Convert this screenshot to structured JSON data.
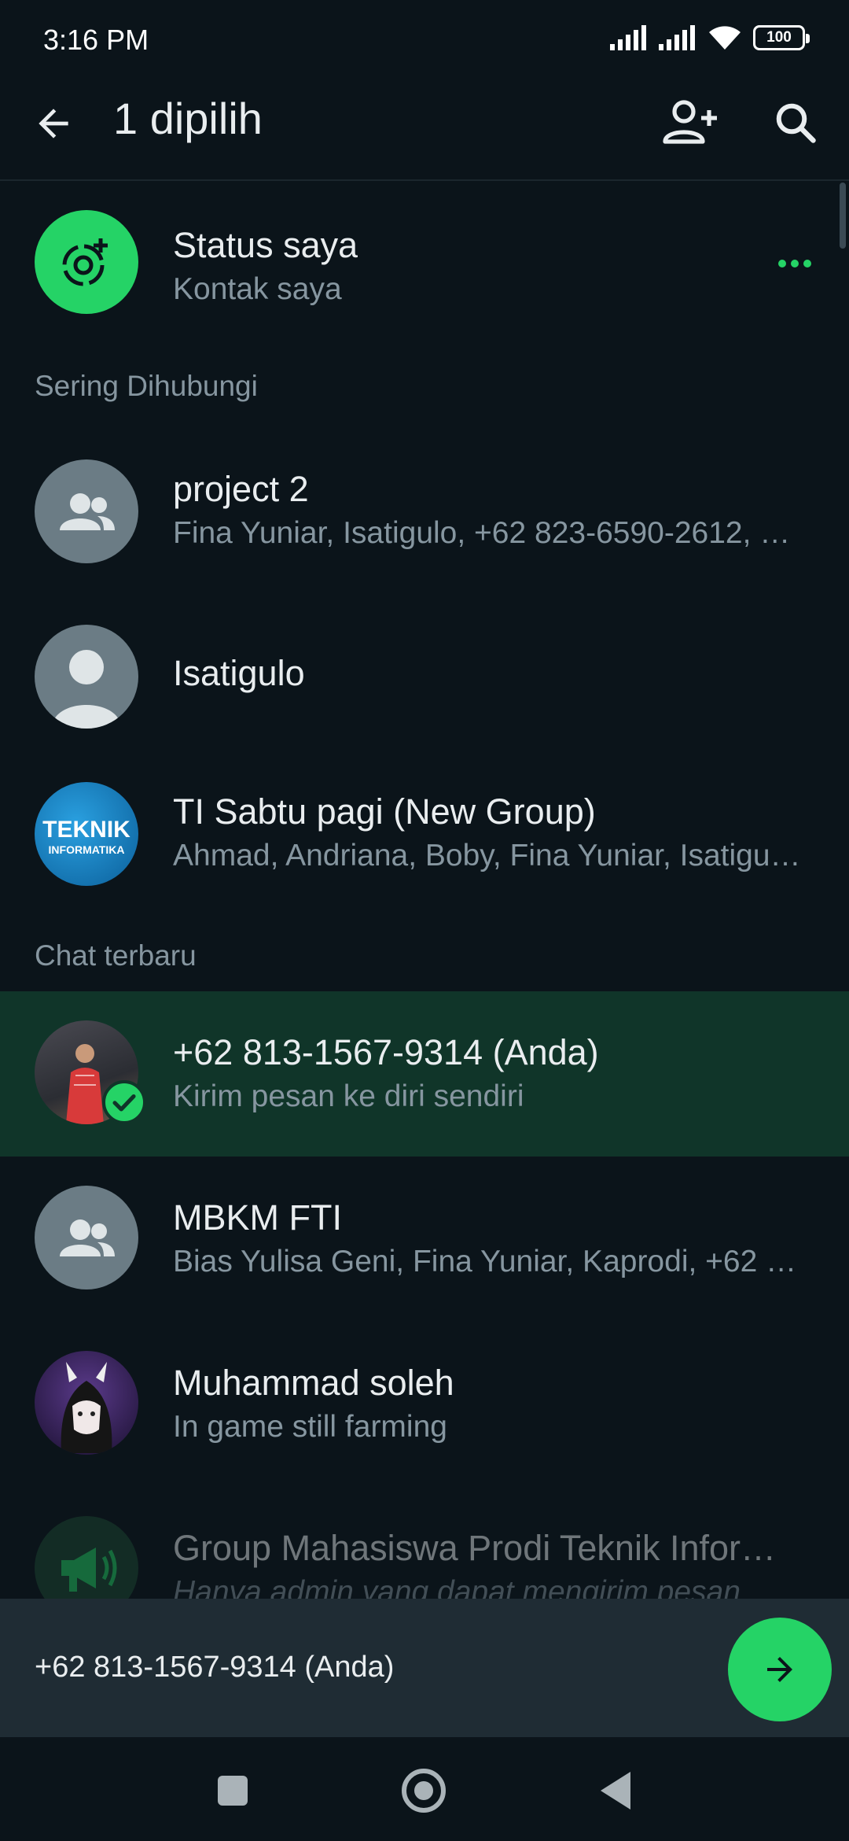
{
  "status_bar": {
    "time": "3:16 PM",
    "battery": "100",
    "icons": [
      "signal-icon",
      "signal-icon",
      "wifi-icon",
      "battery-icon"
    ]
  },
  "app_bar": {
    "title": "1 dipilih",
    "icons": [
      "back-arrow-icon",
      "add-contact-icon",
      "search-icon"
    ]
  },
  "my_status": {
    "name": "Status saya",
    "subtitle": "Kontak saya"
  },
  "sections": {
    "frequent": "Sering Dihubungi",
    "recent": "Chat terbaru"
  },
  "frequent_contacts": [
    {
      "name": "project 2",
      "subtitle": "Fina Yuniar, Isatigulo, +62 823-6590-2612, …",
      "avatar": "group-icon"
    },
    {
      "name": "Isatigulo",
      "subtitle": "",
      "avatar": "person-icon"
    },
    {
      "name": "TI Sabtu pagi (New Group)",
      "subtitle": "Ahmad, Andriana, Boby, Fina Yuniar, Isatigu…",
      "avatar": "teknik-informatika-logo",
      "avatar_text": [
        "TEKNIK",
        "INFORMATIKA"
      ]
    }
  ],
  "recent_chats": [
    {
      "name": "+62 813-1567-9314 (Anda)",
      "subtitle": "Kirim pesan ke diri sendiri",
      "avatar": "user-photo",
      "selected": true
    },
    {
      "name": "MBKM FTI",
      "subtitle": "Bias Yulisa Geni, Fina Yuniar, Kaprodi, +62 …",
      "avatar": "group-icon",
      "selected": false
    },
    {
      "name": "Muhammad soleh",
      "subtitle": "In game still farming",
      "avatar": "anime-avatar",
      "selected": false
    },
    {
      "name": "Group Mahasiswa Prodi Teknik Infor…",
      "subtitle": "Hanya admin yang dapat mengirim pesan",
      "avatar": "megaphone-icon",
      "selected": false
    }
  ],
  "selection_bar": {
    "text": "+62 813-1567-9314 (Anda)",
    "send_icon": "arrow-right-icon"
  },
  "colors": {
    "background": "#0b141a",
    "accent": "#25d366",
    "selected_row": "#103529",
    "secondary_text": "#8696a0"
  }
}
